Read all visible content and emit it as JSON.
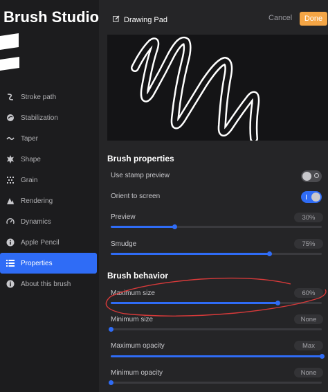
{
  "sidebar": {
    "title": "Brush Studio",
    "items": [
      {
        "label": "Stroke path",
        "icon": "stroke-path-icon"
      },
      {
        "label": "Stabilization",
        "icon": "stabilization-icon"
      },
      {
        "label": "Taper",
        "icon": "taper-icon"
      },
      {
        "label": "Shape",
        "icon": "shape-icon"
      },
      {
        "label": "Grain",
        "icon": "grain-icon"
      },
      {
        "label": "Rendering",
        "icon": "rendering-icon"
      },
      {
        "label": "Dynamics",
        "icon": "dynamics-icon"
      },
      {
        "label": "Apple Pencil",
        "icon": "apple-pencil-icon"
      },
      {
        "label": "Properties",
        "icon": "properties-icon",
        "active": true
      },
      {
        "label": "About this brush",
        "icon": "info-icon"
      }
    ]
  },
  "header": {
    "pad_label": "Drawing Pad",
    "cancel_label": "Cancel",
    "done_label": "Done"
  },
  "properties": {
    "title": "Brush properties",
    "use_stamp_preview": {
      "label": "Use stamp preview",
      "on": false
    },
    "orient_to_screen": {
      "label": "Orient to screen",
      "on": true
    },
    "preview": {
      "label": "Preview",
      "value": "30%",
      "level": 0.3
    },
    "smudge": {
      "label": "Smudge",
      "value": "75%",
      "level": 0.75
    }
  },
  "behavior": {
    "title": "Brush behavior",
    "max_size": {
      "label": "Maximum size",
      "value": "60%",
      "level": 0.79
    },
    "min_size": {
      "label": "Minimum size",
      "value": "None",
      "level": 0.0
    },
    "max_opacity": {
      "label": "Maximum opacity",
      "value": "Max",
      "level": 1.0
    },
    "min_opacity": {
      "label": "Minimum opacity",
      "value": "None",
      "level": 0.0
    }
  },
  "colors": {
    "accent": "#2f6cf6",
    "done": "#f4a545",
    "annotation": "#d93a3a"
  }
}
